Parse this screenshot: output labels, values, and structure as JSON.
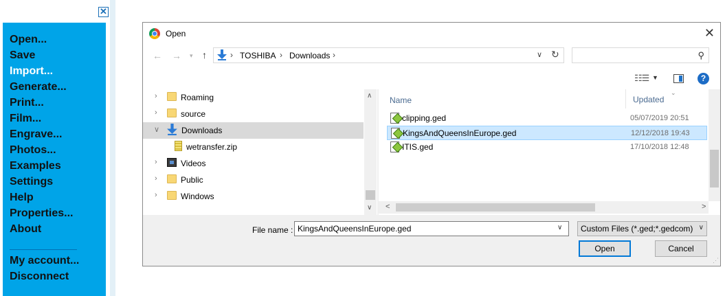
{
  "app": {
    "close_symbol": "✕",
    "menu_items": [
      {
        "label": "Open..."
      },
      {
        "label": "Save"
      },
      {
        "label": "Import..."
      },
      {
        "label": "Generate..."
      },
      {
        "label": "Print..."
      },
      {
        "label": "Film..."
      },
      {
        "label": "Engrave..."
      },
      {
        "label": "Photos..."
      },
      {
        "label": "Examples"
      },
      {
        "label": "Settings"
      },
      {
        "label": "Help"
      },
      {
        "label": "Properties..."
      },
      {
        "label": "About"
      }
    ],
    "account_items": [
      {
        "label": "My account..."
      },
      {
        "label": "Disconnect"
      }
    ],
    "active_item": "Import...",
    "accent_color": "#00a4e8"
  },
  "dialog": {
    "title": "Open",
    "icon": "chrome-icon",
    "breadcrumb": [
      "TOSHIBA",
      "Downloads"
    ],
    "search_placeholder": "",
    "tree": [
      {
        "label": "Roaming",
        "icon": "folder-icon",
        "expandable": true
      },
      {
        "label": "source",
        "icon": "folder-icon",
        "expandable": true
      },
      {
        "label": "Downloads",
        "icon": "downloads-icon",
        "expandable": true,
        "expanded": true,
        "selected": true
      },
      {
        "label": "wetransfer.zip",
        "icon": "zip-icon",
        "expandable": false
      },
      {
        "label": "Videos",
        "icon": "video-icon",
        "expandable": true
      },
      {
        "label": "Public",
        "icon": "folder-icon",
        "expandable": true
      },
      {
        "label": "Windows",
        "icon": "folder-icon",
        "expandable": true
      }
    ],
    "columns": {
      "name": "Name",
      "updated": "Updated"
    },
    "files": [
      {
        "name": "clipping.ged",
        "updated": "05/07/2019 20:51",
        "selected": false
      },
      {
        "name": "KingsAndQueensInEurope.ged",
        "updated": "12/12/2018 19:43",
        "selected": true
      },
      {
        "name": "ITIS.ged",
        "updated": "17/10/2018 12:48",
        "selected": false
      }
    ],
    "file_name_label": "File name :",
    "file_name_value": "KingsAndQueensInEurope.ged",
    "filter_value": "Custom Files (*.ged;*.gedcom)",
    "open_label": "Open",
    "cancel_label": "Cancel"
  }
}
